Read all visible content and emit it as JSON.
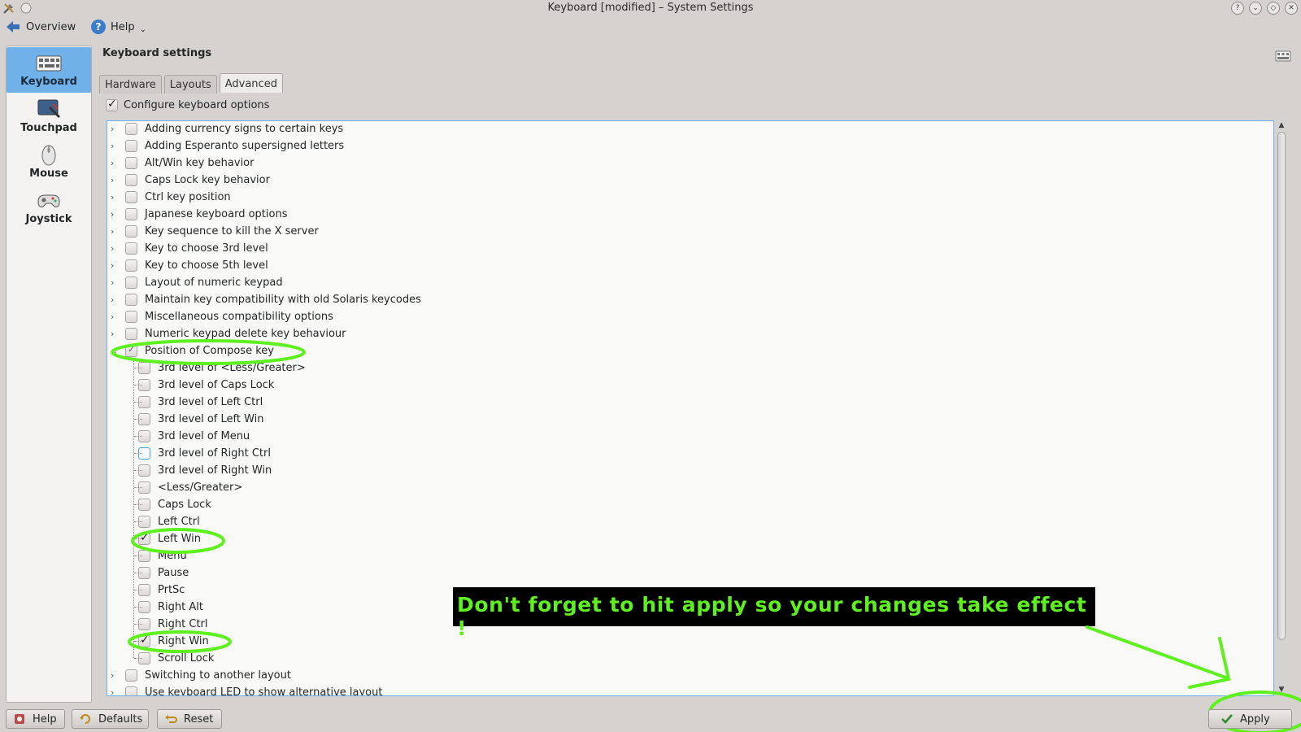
{
  "window": {
    "title": "Keyboard [modified] – System Settings"
  },
  "toolbar": {
    "overview_label": "Overview",
    "help_label": "Help"
  },
  "sidebar": {
    "items": [
      {
        "label": "Keyboard",
        "icon": "keyboard-icon",
        "active": true
      },
      {
        "label": "Touchpad",
        "icon": "touchpad-icon",
        "active": false
      },
      {
        "label": "Mouse",
        "icon": "mouse-icon",
        "active": false
      },
      {
        "label": "Joystick",
        "icon": "joystick-icon",
        "active": false
      }
    ]
  },
  "main": {
    "title": "Keyboard settings",
    "tabs": [
      {
        "label": "Hardware",
        "active": false
      },
      {
        "label": "Layouts",
        "active": false
      },
      {
        "label": "Advanced",
        "active": true
      }
    ],
    "configure_label": "Configure keyboard options",
    "configure_checked": true
  },
  "tree": {
    "groups_before": [
      "Adding currency signs to certain keys",
      "Adding Esperanto supersigned letters",
      "Alt/Win key behavior",
      "Caps Lock key behavior",
      "Ctrl key position",
      "Japanese keyboard options",
      "Key sequence to kill the X server",
      "Key to choose 3rd level",
      "Key to choose 5th level",
      "Layout of numeric keypad",
      "Maintain key compatibility with old Solaris keycodes",
      "Miscellaneous compatibility options",
      "Numeric keypad delete key behaviour"
    ],
    "expanded_group": {
      "label": "Position of Compose key",
      "state": "partial",
      "children": [
        {
          "label": "3rd level of <Less/Greater>",
          "checked": false
        },
        {
          "label": "3rd level of Caps Lock",
          "checked": false
        },
        {
          "label": "3rd level of Left Ctrl",
          "checked": false
        },
        {
          "label": "3rd level of Left Win",
          "checked": false
        },
        {
          "label": "3rd level of Menu",
          "checked": false
        },
        {
          "label": "3rd level of Right Ctrl",
          "checked": false
        },
        {
          "label": "3rd level of Right Win",
          "checked": false
        },
        {
          "label": "<Less/Greater>",
          "checked": false
        },
        {
          "label": "Caps Lock",
          "checked": false
        },
        {
          "label": "Left Ctrl",
          "checked": false
        },
        {
          "label": "Left Win",
          "checked": true
        },
        {
          "label": "Menu",
          "checked": false
        },
        {
          "label": "Pause",
          "checked": false
        },
        {
          "label": "PrtSc",
          "checked": false
        },
        {
          "label": "Right Alt",
          "checked": false
        },
        {
          "label": "Right Ctrl",
          "checked": false
        },
        {
          "label": "Right Win",
          "checked": true
        },
        {
          "label": "Scroll Lock",
          "checked": false
        }
      ]
    },
    "groups_after": [
      "Switching to another layout",
      "Use keyboard LED to show alternative layout"
    ]
  },
  "annotation": {
    "text": "Don't forget to hit apply so your changes take effect !",
    "color": "#5ef01f"
  },
  "footer": {
    "help_label": "Help",
    "defaults_label": "Defaults",
    "reset_label": "Reset",
    "apply_label": "Apply"
  },
  "colors": {
    "accent": "#6fb1e8",
    "annotation_green": "#5ef01f"
  }
}
